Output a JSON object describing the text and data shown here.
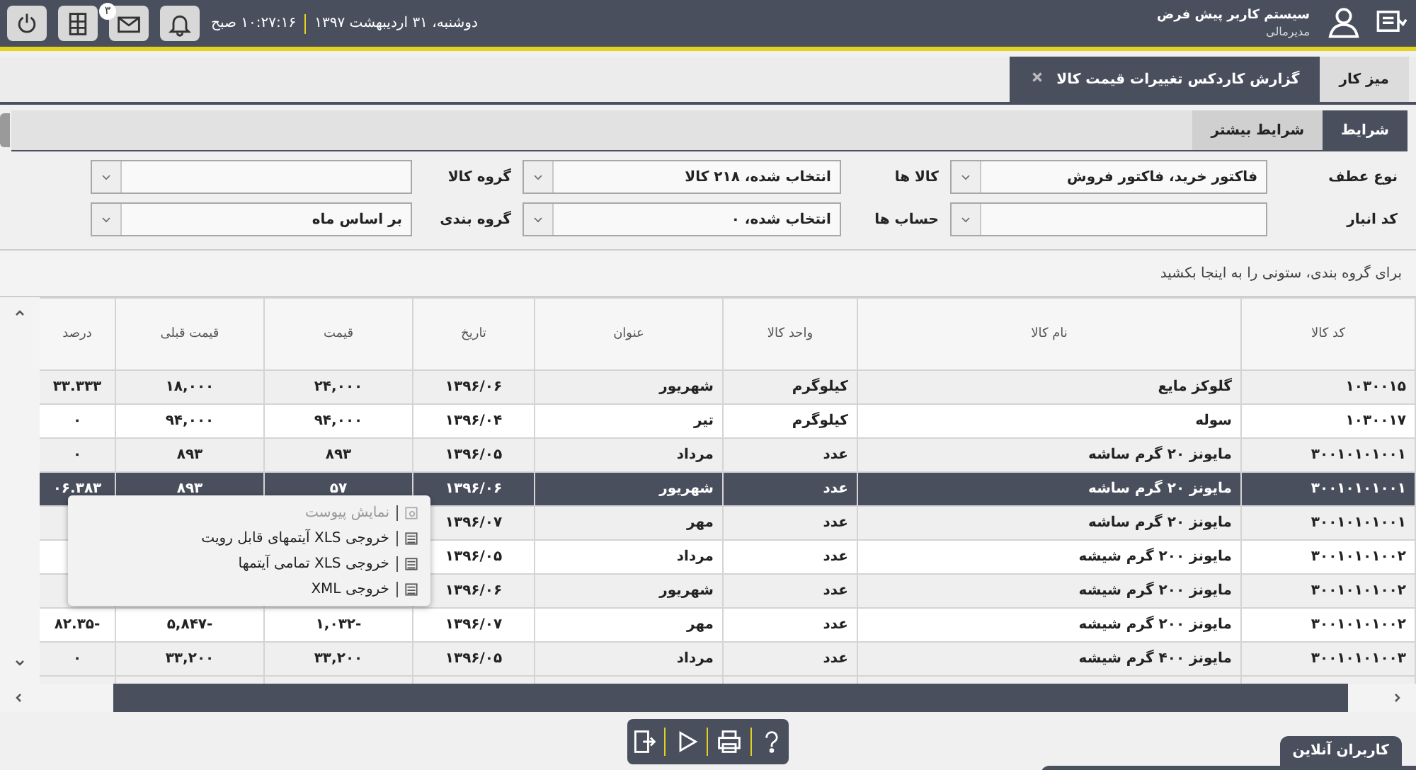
{
  "topbar": {
    "user_name": "سیستم کاربر پیش فرض",
    "user_role": "مدیرمالی",
    "date": "دوشنبه، ۳۱ اردیبهشت ۱۳۹۷",
    "time": "۱۰:۲۷:۱۶ صبح",
    "mail_badge": "۳"
  },
  "tabs": [
    {
      "label": "میز کار",
      "selected": false,
      "closable": false
    },
    {
      "label": "گزارش کاردکس تغییرات قیمت کالا",
      "selected": true,
      "closable": true
    }
  ],
  "subtabs": [
    {
      "label": "شرایط",
      "selected": true
    },
    {
      "label": "شرایط بیشتر",
      "selected": false
    }
  ],
  "filters": [
    {
      "label": "نوع عطف",
      "value": "فاکتور خرید، فاکتور فروش"
    },
    {
      "label": "کالا ها",
      "value": "انتخاب شده، ۲۱۸ کالا"
    },
    {
      "label": "گروه کالا"
    },
    {
      "label": "کد انبار"
    },
    {
      "label": "حساب ها",
      "value": "انتخاب شده، ۰"
    },
    {
      "label": "گروه بندی",
      "value": "بر اساس ماه"
    }
  ],
  "grid": {
    "group_hint": "برای گروه بندی، ستونی را به اینجا بکشید",
    "columns": [
      "کد کالا",
      "نام کالا",
      "واحد کالا",
      "عنوان",
      "تاریخ",
      "قیمت",
      "قیمت قبلی",
      "درصد"
    ],
    "rows": [
      {
        "selected": false,
        "cells": [
          "۱۰۳۰۰۱۵",
          "گلوکز مایع",
          "کیلوگرم",
          "شهریور",
          "۱۳۹۶/۰۶",
          "۲۴,۰۰۰",
          "۱۸,۰۰۰",
          "۳۳.۳۳۳"
        ]
      },
      {
        "selected": false,
        "cells": [
          "۱۰۳۰۰۱۷",
          "سوله",
          "کیلوگرم",
          "تیر",
          "۱۳۹۶/۰۴",
          "۹۴,۰۰۰",
          "۹۴,۰۰۰",
          "۰"
        ]
      },
      {
        "selected": false,
        "cells": [
          "۳۰۰۱۰۱۰۱۰۰۱",
          "مایونز ۲۰ گرم ساشه",
          "عدد",
          "مرداد",
          "۱۳۹۶/۰۵",
          "۸۹۳",
          "۸۹۳",
          "۰"
        ]
      },
      {
        "selected": true,
        "cells": [
          "۳۰۰۱۰۱۰۱۰۰۱",
          "مایونز ۲۰ گرم ساشه",
          "عدد",
          "شهریور",
          "۱۳۹۶/۰۶",
          "۵۷",
          "۸۹۳",
          "۰۶.۳۸۳"
        ]
      },
      {
        "selected": false,
        "cells": [
          "۳۰۰۱۰۱۰۱۰۰۱",
          "مایونز ۲۰ گرم ساشه",
          "عدد",
          "مهر",
          "۱۳۹۶/۰۷",
          null,
          null,
          null
        ]
      },
      {
        "selected": false,
        "cells": [
          "۳۰۰۱۰۱۰۱۰۰۲",
          "مایونز ۲۰۰ گرم شیشه",
          "عدد",
          "مرداد",
          "۱۳۹۶/۰۵",
          null,
          null,
          null
        ]
      },
      {
        "selected": false,
        "cells": [
          "۳۰۰۱۰۱۰۱۰۰۲",
          "مایونز ۲۰۰ گرم شیشه",
          "عدد",
          "شهریور",
          "۱۳۹۶/۰۶",
          null,
          null,
          null
        ]
      },
      {
        "selected": false,
        "cells": [
          "۳۰۰۱۰۱۰۱۰۰۲",
          "مایونز ۲۰۰ گرم شیشه",
          "عدد",
          "مهر",
          "۱۳۹۶/۰۷",
          "۱,۰۳۲-",
          "۵,۸۴۷-",
          "۸۲.۳۵-"
        ]
      },
      {
        "selected": false,
        "cells": [
          "۳۰۰۱۰۱۰۱۰۰۳",
          "مایونز ۴۰۰ گرم شیشه",
          "عدد",
          "مرداد",
          "۱۳۹۶/۰۵",
          "۳۳,۲۰۰",
          "۳۳,۲۰۰",
          "۰"
        ]
      }
    ]
  },
  "context_menu": [
    {
      "label": "نمایش پیوست",
      "disabled": true
    },
    {
      "label": "خروجی XLS آیتمهای قابل رویت",
      "disabled": false
    },
    {
      "label": "خروجی XLS تمامی آیتمها",
      "disabled": false
    },
    {
      "label": "خروجی XML",
      "disabled": false
    }
  ],
  "online_users": {
    "label": "کاربران آنلاین"
  }
}
